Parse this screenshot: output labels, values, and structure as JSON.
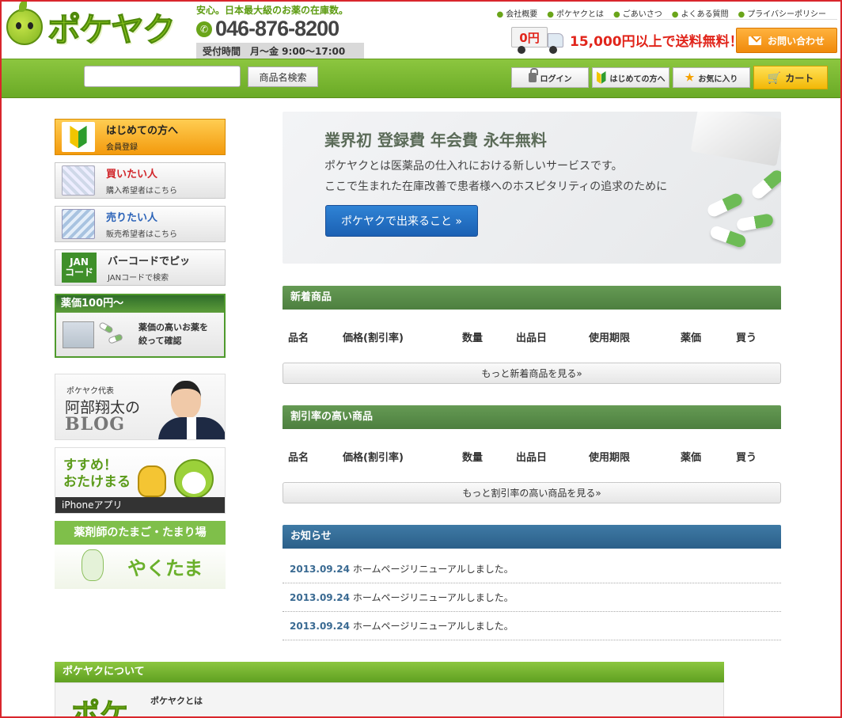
{
  "header": {
    "logo_text": "ポケヤク",
    "tagline": "安心。日本最大級のお薬の在庫数。",
    "phone": "046-876-8200",
    "hours": "受付時間　月〜金 9:00〜17:00",
    "top_links": [
      "会社概要",
      "ポケヤクとは",
      "ごあいさつ",
      "よくある質問",
      "プライバシーポリシー"
    ],
    "shipping_price": "0円",
    "shipping_text": "15,000円以上で送料無料！",
    "contact_label": "お問い合わせ"
  },
  "navbar": {
    "search_placeholder": "",
    "search_button": "商品名検索",
    "login": "ログイン",
    "first_time": "はじめての方へ",
    "favorites": "お気に入り",
    "cart": "カート"
  },
  "sidebar": {
    "cards": [
      {
        "title": "はじめての方へ",
        "sub": "会員登録"
      },
      {
        "title": "買いたい人",
        "sub": "購入希望者はこちら"
      },
      {
        "title": "売りたい人",
        "sub": "販売希望者はこちら"
      },
      {
        "title": "バーコードでピッ",
        "sub": "JANコードで検索",
        "badge_line1": "JAN",
        "badge_line2": "コード"
      }
    ],
    "price_box": {
      "head": "薬価100円〜",
      "line1": "薬価の高いお薬を",
      "line2": "絞って確認"
    },
    "blog": {
      "line1": "ポケヤク代表",
      "line2": "阿部翔太の",
      "line3": "BLOG"
    },
    "app": {
      "line1": "すすめ！",
      "line2": "おたけまる",
      "footer": "iPhoneアプリ"
    },
    "yakutama": {
      "head": "薬剤師のたまご・たまり場",
      "title": "やくたま"
    }
  },
  "hero": {
    "title": "業界初 登録費 年会費 永年無料",
    "line1": "ポケヤクとは医薬品の仕入れにおける新しいサービスです。",
    "line2": "ここで生まれた在庫改善で患者様へのホスピタリティの追求のために",
    "button": "ポケヤクで出来ること »"
  },
  "new_items": {
    "title": "新着商品",
    "columns": [
      "品名",
      "価格(割引率)",
      "数量",
      "出品日",
      "使用期限",
      "薬価",
      "買う"
    ],
    "more": "もっと新着商品を見る»"
  },
  "discount_items": {
    "title": "割引率の高い商品",
    "columns": [
      "品名",
      "価格(割引率)",
      "数量",
      "出品日",
      "使用期限",
      "薬価",
      "買う"
    ],
    "more": "もっと割引率の高い商品を見る»"
  },
  "news": {
    "title": "お知らせ",
    "items": [
      {
        "date": "2013.09.24",
        "text": "ホームページリニューアルしました。"
      },
      {
        "date": "2013.09.24",
        "text": "ホームページリニューアルしました。"
      },
      {
        "date": "2013.09.24",
        "text": "ホームページリニューアルしました。"
      }
    ]
  },
  "about": {
    "title": "ポケヤクについて",
    "logo_partial": "ポケ",
    "subtitle": "ポケヤクとは"
  }
}
